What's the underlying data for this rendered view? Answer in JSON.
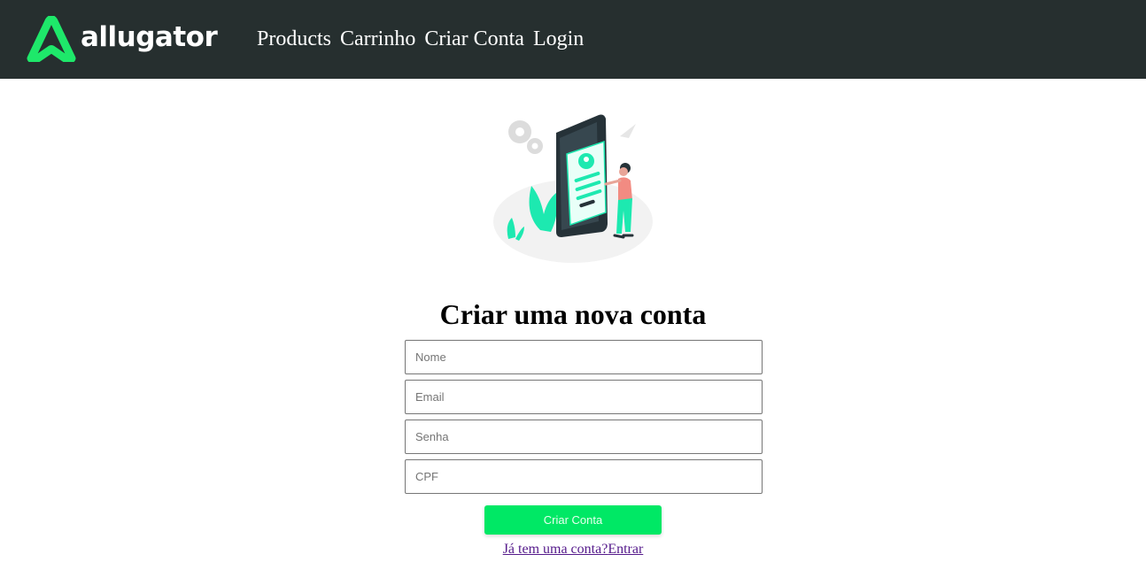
{
  "header": {
    "brand": "allugator",
    "nav": [
      "Products",
      "Carrinho",
      "Criar Conta",
      "Login"
    ]
  },
  "form": {
    "title": "Criar uma nova conta",
    "fields": [
      {
        "placeholder": "Nome"
      },
      {
        "placeholder": "Email"
      },
      {
        "placeholder": "Senha"
      },
      {
        "placeholder": "CPF"
      }
    ],
    "submit_label": "Criar Conta",
    "login_prompt": "Já tem uma conta?",
    "login_link": "Entrar"
  },
  "colors": {
    "header_bg": "#262f2f",
    "accent": "#00e865",
    "logo_green": "#1ee86a"
  },
  "icons": {
    "logo": "allugator-a-logo-icon",
    "illustration": "create-account-illustration"
  }
}
